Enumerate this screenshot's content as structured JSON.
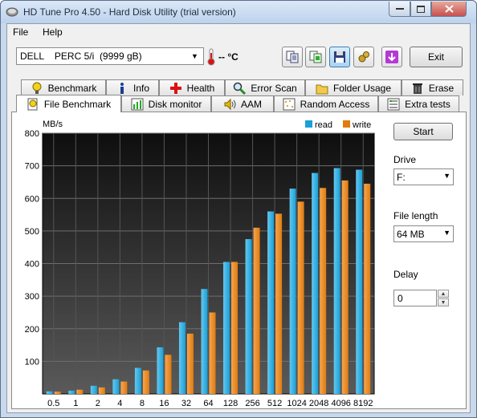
{
  "window": {
    "title": "HD Tune Pro 4.50 - Hard Disk Utility (trial version)"
  },
  "menu": {
    "file": "File",
    "help": "Help"
  },
  "toolbar": {
    "drive_model": "DELL    PERC 5/i",
    "drive_capacity": "(9999 gB)",
    "temperature": "-- °C",
    "buttons": [
      "copy-info-icon",
      "copy-screen-icon",
      "save-icon",
      "options-icon",
      "download-icon"
    ],
    "exit_label": "Exit"
  },
  "tabs": {
    "row1": [
      {
        "label": "Benchmark",
        "icon": "benchmark-icon"
      },
      {
        "label": "Info",
        "icon": "info-icon"
      },
      {
        "label": "Health",
        "icon": "health-icon"
      },
      {
        "label": "Error Scan",
        "icon": "error-scan-icon"
      },
      {
        "label": "Folder Usage",
        "icon": "folder-icon"
      },
      {
        "label": "Erase",
        "icon": "erase-icon"
      }
    ],
    "row2": [
      {
        "label": "File Benchmark",
        "icon": "file-benchmark-icon",
        "selected": true
      },
      {
        "label": "Disk monitor",
        "icon": "disk-monitor-icon"
      },
      {
        "label": "AAM",
        "icon": "aam-icon"
      },
      {
        "label": "Random Access",
        "icon": "random-access-icon"
      },
      {
        "label": "Extra tests",
        "icon": "extra-tests-icon"
      }
    ]
  },
  "panel": {
    "start_label": "Start",
    "drive_label": "Drive",
    "drive_value": "F:",
    "file_length_label": "File length",
    "file_length_value": "64 MB",
    "delay_label": "Delay",
    "delay_value": "0"
  },
  "colors": {
    "read": "#1a9fd6",
    "write": "#e07b10",
    "plot_bg_top": "#0e0e0e",
    "plot_bg_bottom": "#5a5a5a"
  },
  "chart_data": {
    "type": "bar",
    "ylabel": "MB/s",
    "ylim": [
      0,
      800
    ],
    "yticks": [
      100,
      200,
      300,
      400,
      500,
      600,
      700,
      800
    ],
    "categories": [
      "0.5",
      "1",
      "2",
      "4",
      "8",
      "16",
      "32",
      "64",
      "128",
      "256",
      "512",
      "1024",
      "2048",
      "4096",
      "8192"
    ],
    "series": [
      {
        "name": "read",
        "values": [
          8,
          10,
          25,
          45,
          80,
          143,
          220,
          322,
          405,
          475,
          560,
          630,
          678,
          693,
          688
        ]
      },
      {
        "name": "write",
        "values": [
          7,
          13,
          20,
          38,
          72,
          120,
          185,
          250,
          405,
          510,
          553,
          590,
          632,
          655,
          645
        ]
      }
    ],
    "legend_position": "top-right",
    "grid": true
  }
}
